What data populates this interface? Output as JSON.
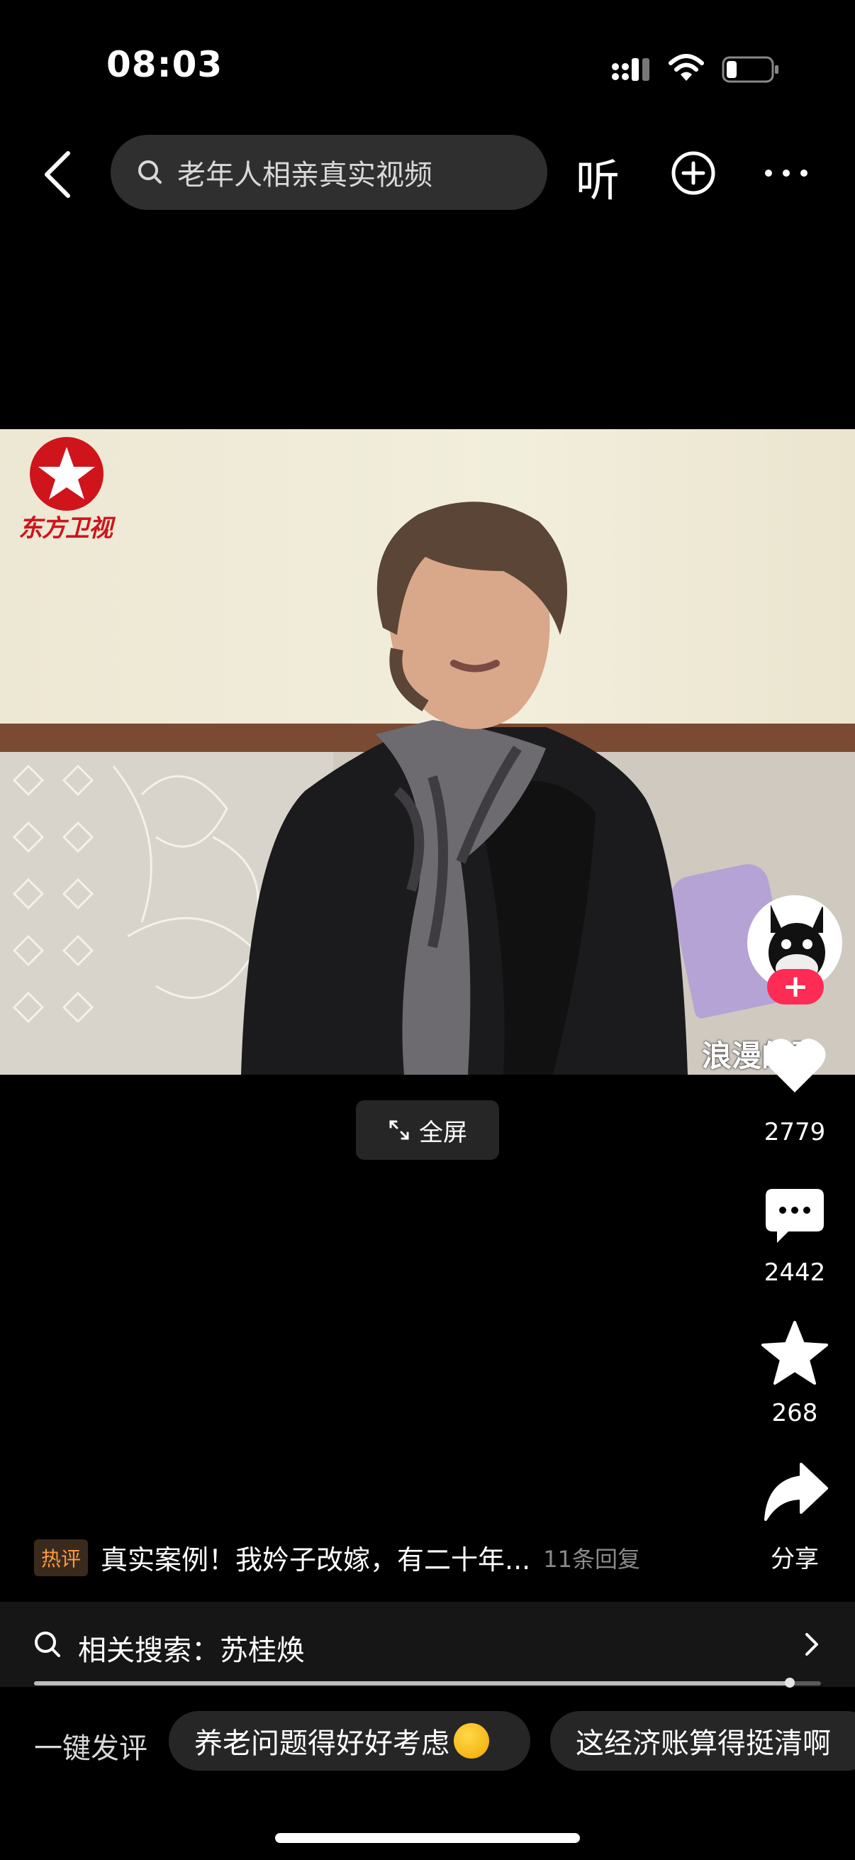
{
  "status_bar": {
    "time": "08:03"
  },
  "top_nav": {
    "search_text": "老年人相亲真实视频",
    "listen_label": "听"
  },
  "video": {
    "channel_logo_text": "东方卫视",
    "watermark": "浪漫的驴",
    "fullscreen_label": "全屏",
    "progress_fraction": 0.96
  },
  "side_actions": {
    "like_count": "2779",
    "comment_count": "2442",
    "favorite_count": "268",
    "share_label": "分享"
  },
  "hot_comment": {
    "badge": "热评",
    "text": "真实案例！我妗子改嫁，有二十年...",
    "replies": "11条回复"
  },
  "related_search": {
    "label": "相关搜索：苏桂焕"
  },
  "quick_comment": {
    "label": "一键发评",
    "chips": [
      "养老问题得好好考虑",
      "这经济账算得挺清啊"
    ]
  },
  "colors": {
    "accent_red": "#fe2c55",
    "hot_orange": "#ff9b3d"
  },
  "icons": [
    "back-icon",
    "search-icon",
    "add-icon",
    "more-icon",
    "heart-icon",
    "comment-icon",
    "star-icon",
    "share-icon",
    "chevron-right-icon",
    "fullscreen-icon"
  ]
}
